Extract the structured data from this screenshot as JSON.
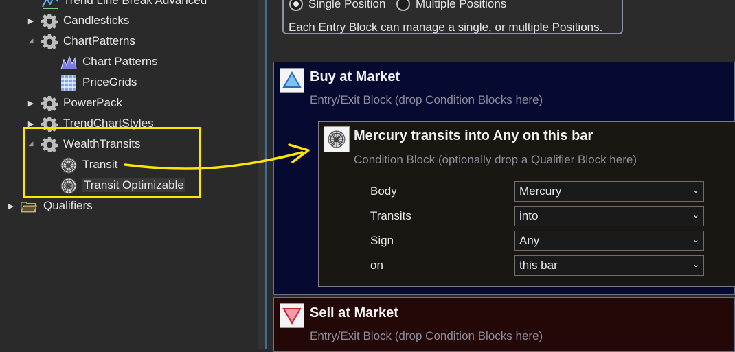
{
  "tree": {
    "items": [
      {
        "label": "Trend Line Break Advanced",
        "icon": "trend-line-icon"
      },
      {
        "label": "Candlesticks",
        "icon": "gear-icon"
      },
      {
        "label": "ChartPatterns",
        "icon": "gear-icon"
      },
      {
        "label": "Chart Patterns",
        "icon": "chart-pattern-icon"
      },
      {
        "label": "PriceGrids",
        "icon": "grid-icon"
      },
      {
        "label": "PowerPack",
        "icon": "gear-icon"
      },
      {
        "label": "TrendChartStyles",
        "icon": "gear-icon"
      },
      {
        "label": "WealthTransits",
        "icon": "gear-icon"
      },
      {
        "label": "Transit",
        "icon": "astro-wheel-icon"
      },
      {
        "label": "Transit Optimizable",
        "icon": "astro-wheel-icon"
      },
      {
        "label": "Qualifiers",
        "icon": "folder-icon"
      }
    ]
  },
  "position_options": {
    "single_label": "Single Position",
    "multiple_label": "Multiple Positions",
    "selected": "single",
    "description": "Each Entry Block can manage a single, or multiple Positions."
  },
  "buy_block": {
    "title": "Buy at Market",
    "subtitle": "Entry/Exit Block (drop Condition Blocks here)",
    "icon": "buy-triangle-icon"
  },
  "condition_block": {
    "title": "Mercury transits into Any on this bar",
    "subtitle": "Condition Block (optionally drop a Qualifier Block here)",
    "icon": "astro-wheel-icon",
    "params": [
      {
        "label": "Body",
        "value": "Mercury"
      },
      {
        "label": "Transits",
        "value": "into"
      },
      {
        "label": "Sign",
        "value": "Any"
      },
      {
        "label": "on",
        "value": "this bar"
      }
    ]
  },
  "sell_block": {
    "title": "Sell at Market",
    "subtitle": "Entry/Exit Block (drop Condition Blocks here)",
    "icon": "sell-triangle-icon"
  },
  "colors": {
    "highlight": "#ffe600",
    "buy_bg": "#060a30",
    "sell_bg": "#240808",
    "condition_bg": "#1a1612"
  }
}
